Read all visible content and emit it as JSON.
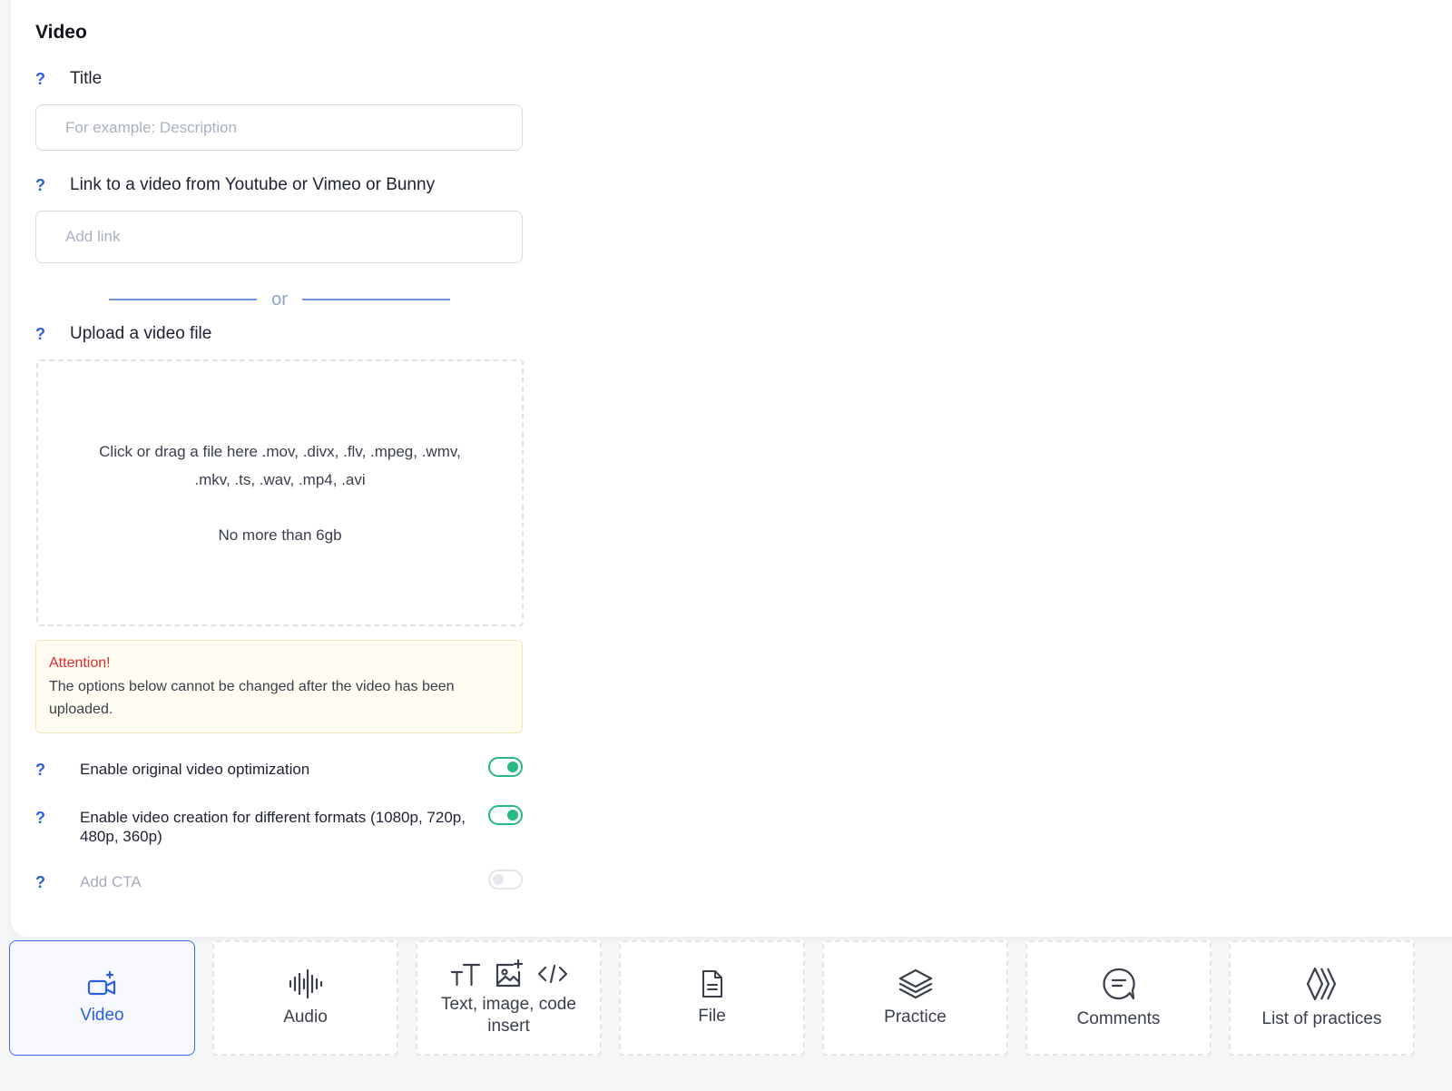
{
  "panel": {
    "title": "Video",
    "title_field": {
      "label": "Title",
      "placeholder": "For example: Description",
      "help": "?"
    },
    "link_field": {
      "label": "Link to a video from Youtube or Vimeo or Bunny",
      "placeholder": "Add link",
      "help": "?"
    },
    "or_text": "or",
    "upload": {
      "label": "Upload a video file",
      "help": "?",
      "formats_text": "Click or drag a file here .mov, .divx, .flv, .mpeg, .wmv, .mkv, .ts, .wav, .mp4, .avi",
      "limit_text": "No more than 6gb"
    },
    "attention": {
      "title": "Attention!",
      "body": "The options below cannot be changed after the video has been uploaded."
    },
    "options": [
      {
        "label": "Enable original video optimization",
        "enabled": true,
        "help": "?"
      },
      {
        "label": "Enable video creation for different formats (1080p, 720p, 480p, 360p)",
        "enabled": true,
        "help": "?"
      },
      {
        "label": "Add CTA",
        "enabled": false,
        "help": "?"
      }
    ]
  },
  "tabs": [
    {
      "label": "Video",
      "icon": "video-add-icon",
      "active": true
    },
    {
      "label": "Audio",
      "icon": "audio-wave-icon",
      "active": false
    },
    {
      "label": "Text, image, code insert",
      "icons": [
        "text-size-icon",
        "image-add-icon",
        "code-icon"
      ],
      "active": false
    },
    {
      "label": "File",
      "icon": "file-icon",
      "active": false
    },
    {
      "label": "Practice",
      "icon": "layers-icon",
      "active": false
    },
    {
      "label": "Comments",
      "icon": "comment-icon",
      "active": false
    },
    {
      "label": "List of practices",
      "icon": "chevrons-icon",
      "active": false
    }
  ],
  "colors": {
    "accent": "#2b5fe0",
    "toggle_on": "#28b884",
    "attention_title": "#dd2b2b"
  }
}
